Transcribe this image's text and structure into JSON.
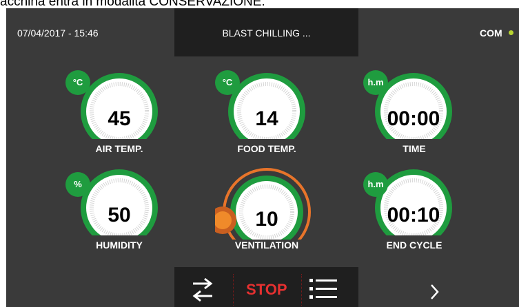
{
  "caption": "acchina entra in modalità CONSERVAZIONE.",
  "header": {
    "datetime": "07/04/2017 - 15:46",
    "title": "BLAST CHILLING ...",
    "com_label": "COM"
  },
  "gauges": [
    {
      "unit": "°C",
      "value": "45",
      "label": "AIR TEMP."
    },
    {
      "unit": "°C",
      "value": "14",
      "label": "FOOD TEMP."
    },
    {
      "unit": "h.m",
      "value": "00:00",
      "label": "TIME"
    },
    {
      "unit": "%",
      "value": "50",
      "label": "HUMIDITY"
    },
    {
      "unit": "",
      "value": "10",
      "label": "VENTILATION"
    },
    {
      "unit": "h.m",
      "value": "00:10",
      "label": "END CYCLE"
    }
  ],
  "toolbar": {
    "stop_label": "STOP",
    "swap_icon": "swap-arrows-icon",
    "list_icon": "list-icon",
    "next_icon": "chevron-right-icon"
  },
  "colors": {
    "panel_bg": "#3a3a3a",
    "accent_green": "#1f9c3f",
    "accent_orange": "#e8742a",
    "stop_red": "#e53030",
    "status_dot": "#b8d430"
  }
}
